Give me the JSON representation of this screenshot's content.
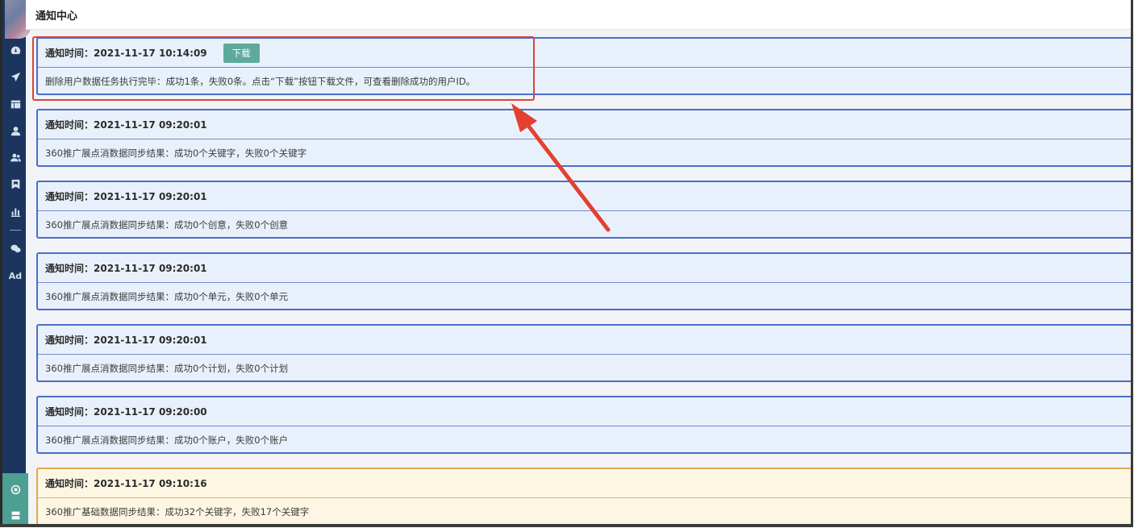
{
  "header": {
    "title": "通知中心"
  },
  "sidebar": {
    "icons": [
      "dashboard-icon",
      "send-icon",
      "table-icon",
      "user-icon",
      "users-icon",
      "bookmark-icon",
      "bar-chart-icon",
      "wechat-icon"
    ],
    "ad_label": "Ad",
    "bottom_icons": [
      "settings-icon",
      "server-icon"
    ]
  },
  "notifications": [
    {
      "time_label": "通知时间：",
      "time": "2021-11-17 10:14:09",
      "message": "删除用户数据任务执行完毕：成功1条，失败0条。点击“下载”按钮下载文件，可查看删除成功的用户ID。",
      "action_label": "下载",
      "highlighted": true,
      "status": "info"
    },
    {
      "time_label": "通知时间：",
      "time": "2021-11-17 09:20:01",
      "message": "360推广展点消数据同步结果：成功0个关键字，失败0个关键字",
      "status": "info"
    },
    {
      "time_label": "通知时间：",
      "time": "2021-11-17 09:20:01",
      "message": "360推广展点消数据同步结果：成功0个创意，失败0个创意",
      "status": "info"
    },
    {
      "time_label": "通知时间：",
      "time": "2021-11-17 09:20:01",
      "message": "360推广展点消数据同步结果：成功0个单元，失败0个单元",
      "status": "info"
    },
    {
      "time_label": "通知时间：",
      "time": "2021-11-17 09:20:01",
      "message": "360推广展点消数据同步结果：成功0个计划，失败0个计划",
      "status": "info"
    },
    {
      "time_label": "通知时间：",
      "time": "2021-11-17 09:20:00",
      "message": "360推广展点消数据同步结果：成功0个账户，失败0个账户",
      "status": "info"
    },
    {
      "time_label": "通知时间：",
      "time": "2021-11-17 09:10:16",
      "message": "360推广基础数据同步结果：成功32个关键字，失败17个关键字",
      "status": "warning"
    }
  ],
  "colors": {
    "sidebar": "#1b355e",
    "info_border": "#4c6dc8",
    "warning_border": "#e3a84a",
    "button": "#5daa9b",
    "annotation": "#d9453a"
  }
}
